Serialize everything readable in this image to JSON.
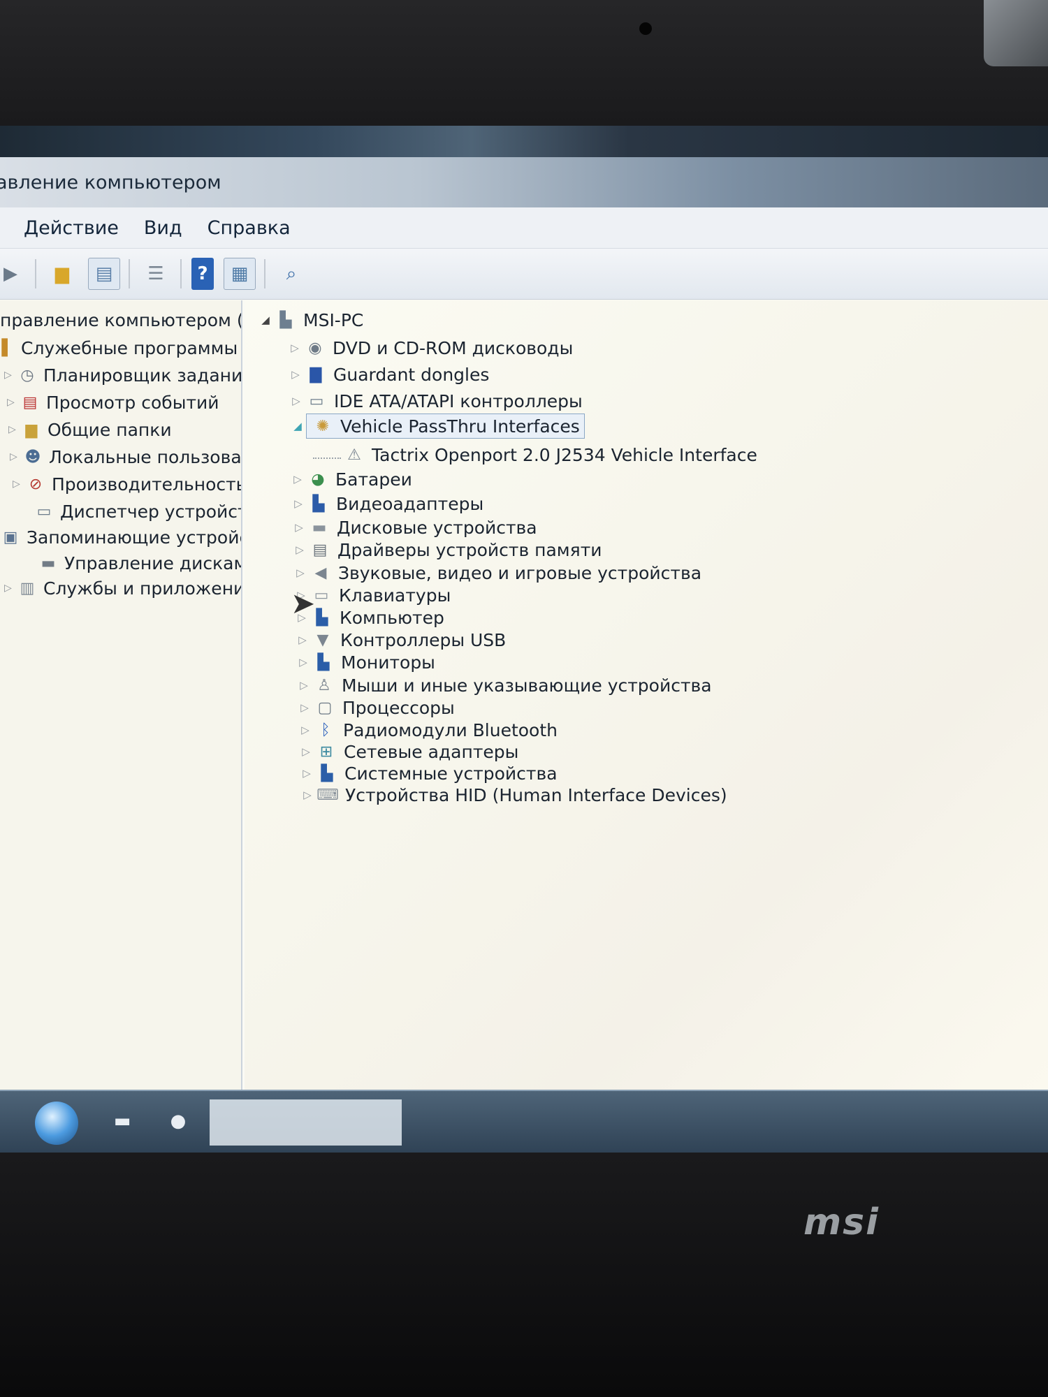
{
  "window": {
    "title": "авление компьютером"
  },
  "menu": {
    "items": [
      "Действие",
      "Вид",
      "Справка"
    ]
  },
  "toolbar": {
    "buttons": [
      "back-arrow-icon",
      "up-folder-icon",
      "show-hide-tree-icon",
      "properties-icon",
      "help-icon",
      "action-pane-icon",
      "scan-hardware-icon"
    ]
  },
  "left_tree": [
    {
      "label": "правление компьютером (л",
      "icon": "computer-management-icon"
    },
    {
      "label": "Служебные программы",
      "icon": "tools-icon"
    },
    {
      "label": "Планировщик заданий",
      "icon": "clock-icon"
    },
    {
      "label": "Просмотр событий",
      "icon": "event-viewer-icon"
    },
    {
      "label": "Общие папки",
      "icon": "shared-folder-icon"
    },
    {
      "label": "Локальные пользовате",
      "icon": "users-icon"
    },
    {
      "label": "Производительность",
      "icon": "performance-icon"
    },
    {
      "label": "Диспетчер устройств",
      "icon": "device-manager-icon"
    },
    {
      "label": "Запоминающие устройст",
      "icon": "storage-icon"
    },
    {
      "label": "Управление дисками",
      "icon": "disk-icon"
    },
    {
      "label": "Службы и приложения",
      "icon": "services-icon"
    }
  ],
  "device_tree": {
    "root": "MSI-PC",
    "items": [
      {
        "label": "DVD и CD-ROM дисководы",
        "icon": "dvd-drive-icon"
      },
      {
        "label": "Guardant dongles",
        "icon": "dongle-icon"
      },
      {
        "label": "IDE ATA/ATAPI контроллеры",
        "icon": "ide-controller-icon"
      },
      {
        "label": "Vehicle PassThru Interfaces",
        "icon": "passthru-icon",
        "selected": true
      },
      {
        "label": "Tactrix Openport 2.0 J2534 Vehicle Interface",
        "icon": "warning-device-icon",
        "child": true
      },
      {
        "label": "Батареи",
        "icon": "battery-icon"
      },
      {
        "label": "Видеоадаптеры",
        "icon": "display-adapter-icon"
      },
      {
        "label": "Дисковые устройства",
        "icon": "disk-drive-icon"
      },
      {
        "label": "Драйверы устройств памяти",
        "icon": "memory-driver-icon"
      },
      {
        "label": "Звуковые, видео и игровые устройства",
        "icon": "sound-icon"
      },
      {
        "label": "Клавиатуры",
        "icon": "keyboard-icon"
      },
      {
        "label": "Компьютер",
        "icon": "computer-icon"
      },
      {
        "label": "Контроллеры USB",
        "icon": "usb-icon"
      },
      {
        "label": "Мониторы",
        "icon": "monitor-icon"
      },
      {
        "label": "Мыши и иные указывающие устройства",
        "icon": "mouse-icon"
      },
      {
        "label": "Процессоры",
        "icon": "cpu-icon"
      },
      {
        "label": "Радиомодули Bluetooth",
        "icon": "bluetooth-icon"
      },
      {
        "label": "Сетевые адаптеры",
        "icon": "network-icon"
      },
      {
        "label": "Системные устройства",
        "icon": "system-device-icon"
      },
      {
        "label": "Устройства HID (Human Interface Devices)",
        "icon": "hid-icon"
      }
    ]
  },
  "bezel": {
    "brand": "msi"
  },
  "colors": {
    "selection_border": "#8aa7c6",
    "taskbar": "#2f4255"
  }
}
